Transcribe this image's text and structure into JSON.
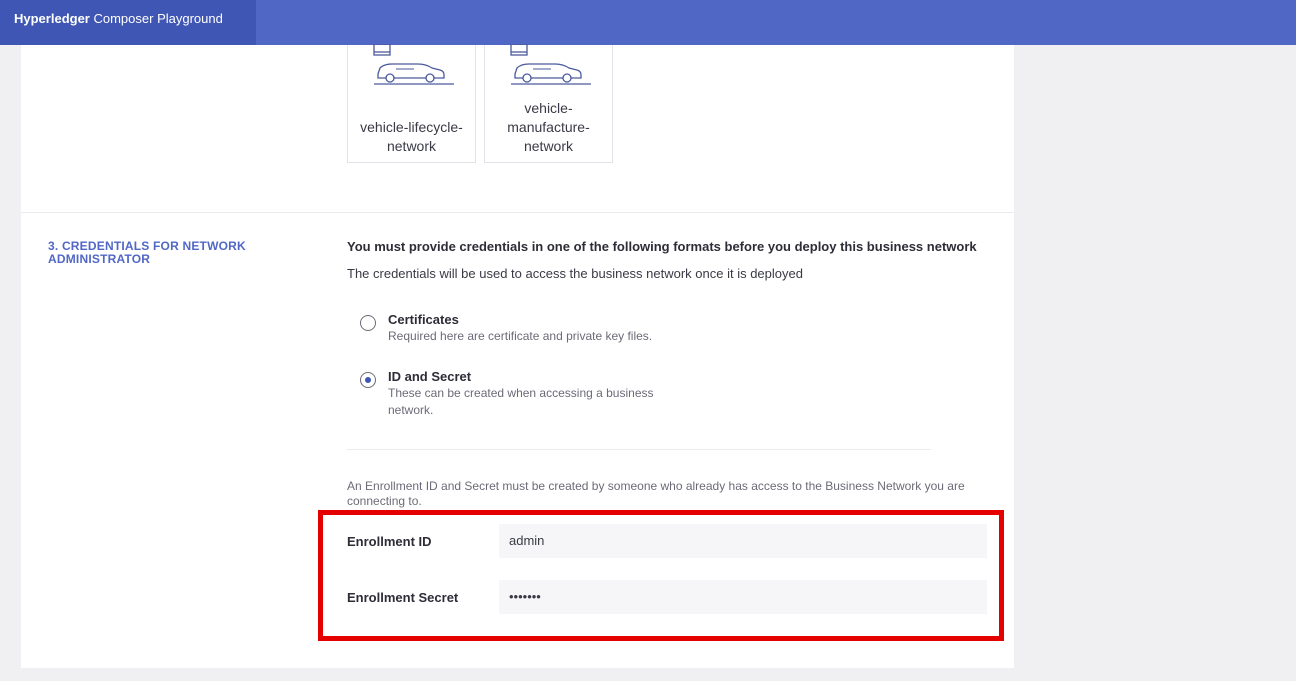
{
  "header": {
    "brand_bold": "Hyperledger",
    "brand_rest": " Composer Playground"
  },
  "samples": [
    {
      "label": "vehicle-lifecycle-network",
      "icon": "vehicle-network-icon"
    },
    {
      "label": "vehicle-manufacture-network",
      "icon": "vehicle-network-icon"
    }
  ],
  "credentials": {
    "section_label": "3. CREDENTIALS FOR NETWORK ADMINISTRATOR",
    "intro_bold": "You must provide credentials in one of the following formats before you deploy this business network",
    "intro": "The credentials will be used to access the business network once it is deployed",
    "options": [
      {
        "title": "Certificates",
        "desc": "Required here are certificate and private key files.",
        "selected": false
      },
      {
        "title": "ID and Secret",
        "desc": "These can be created when accessing a business network.",
        "selected": true
      }
    ],
    "note": "An Enrollment ID and Secret must be created by someone who already has access to the Business Network you are connecting to.",
    "enrollment_id_label": "Enrollment ID",
    "enrollment_id_value": "admin",
    "enrollment_secret_label": "Enrollment Secret",
    "enrollment_secret_value": "•••••••"
  },
  "colors": {
    "brand": "#3f56b4",
    "topbar": "#5167c5",
    "highlight": "#e50000"
  }
}
